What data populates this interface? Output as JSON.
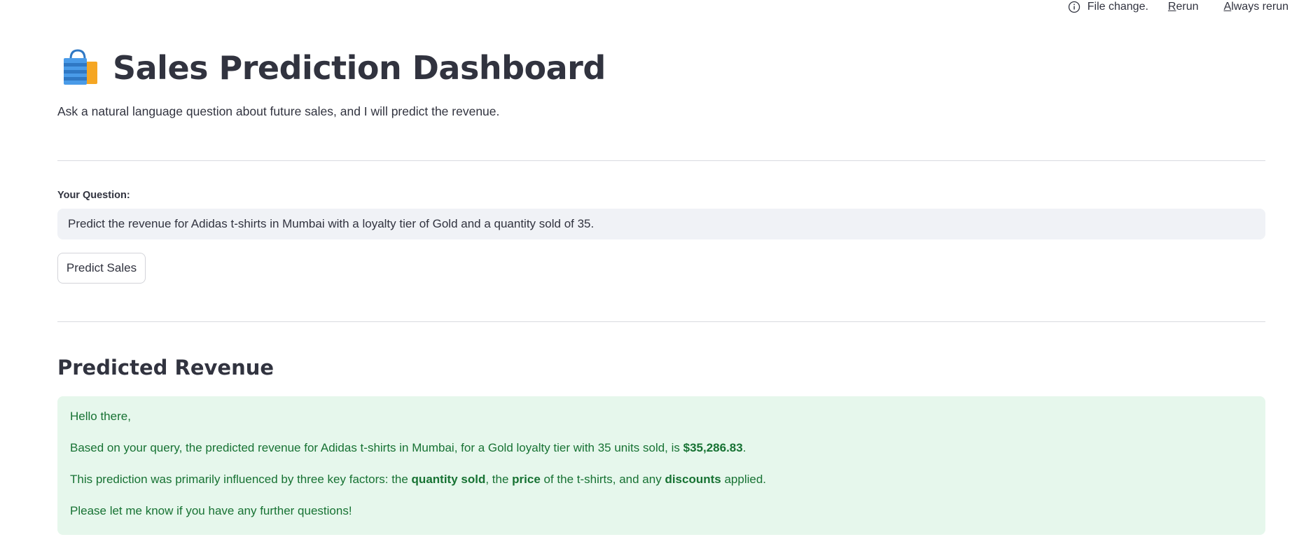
{
  "topbar": {
    "status_text": "File change.",
    "rerun_first": "R",
    "rerun_rest": "erun",
    "always_first": "A",
    "always_rest": "lways rerun"
  },
  "header": {
    "emoji_icon": "shopping-bags-icon",
    "title": "Sales Prediction Dashboard",
    "subtitle": "Ask a natural language question about future sales, and I will predict the revenue."
  },
  "question": {
    "label": "Your Question:",
    "value": "Predict the revenue for Adidas t-shirts in Mumbai with a loyalty tier of Gold and a quantity sold of 35."
  },
  "predict_button": {
    "label": "Predict Sales"
  },
  "result": {
    "heading": "Predicted Revenue",
    "greeting": "Hello there,",
    "line2_pre": "Based on your query, the predicted revenue for Adidas t-shirts in Mumbai, for a Gold loyalty tier with 35 units sold, is ",
    "line2_amount": "$35,286.83",
    "line2_post": ".",
    "line3_pre": "This prediction was primarily influenced by three key factors: the ",
    "line3_b1": "quantity sold",
    "line3_mid1": ", the ",
    "line3_b2": "price",
    "line3_mid2": " of the t-shirts, and any ",
    "line3_b3": "discounts",
    "line3_post": " applied.",
    "closing": "Please let me know if you have any further questions!"
  },
  "colors": {
    "success_bg": "#e6f7ec",
    "success_text": "#177233",
    "input_bg": "#f0f2f6",
    "text": "#31333f"
  }
}
